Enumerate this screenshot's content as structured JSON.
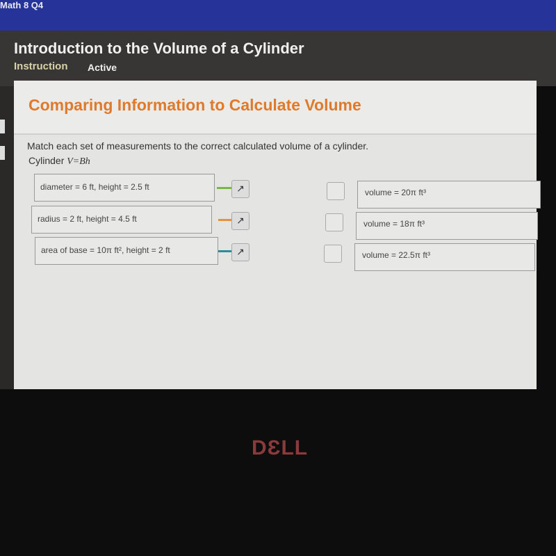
{
  "topbar": {
    "course": "Math 8 Q4"
  },
  "header": {
    "title": "Introduction to the Volume of a Cylinder",
    "tabs": [
      {
        "label": "Instruction"
      },
      {
        "label": "Active"
      }
    ]
  },
  "activity": {
    "title": "Comparing Information to Calculate Volume",
    "instruction": "Match each set of measurements to the correct calculated volume of a cylinder.",
    "formula_prefix": "Cylinder ",
    "formula": "V=Bh",
    "left_items": [
      {
        "label": "diameter = 6 ft, height = 2.5 ft",
        "color": "#7ab648"
      },
      {
        "label": "radius = 2 ft, height = 4.5 ft",
        "color": "#e8913a"
      },
      {
        "label": "area of base = 10π ft², height = 2 ft",
        "color": "#2f8a9a"
      }
    ],
    "right_items": [
      {
        "label": "volume = 20π ft³"
      },
      {
        "label": "volume = 18π ft³"
      },
      {
        "label": "volume = 22.5π ft³"
      }
    ],
    "arrow_icon": "↗"
  },
  "bezel": {
    "logo": "DELL"
  }
}
